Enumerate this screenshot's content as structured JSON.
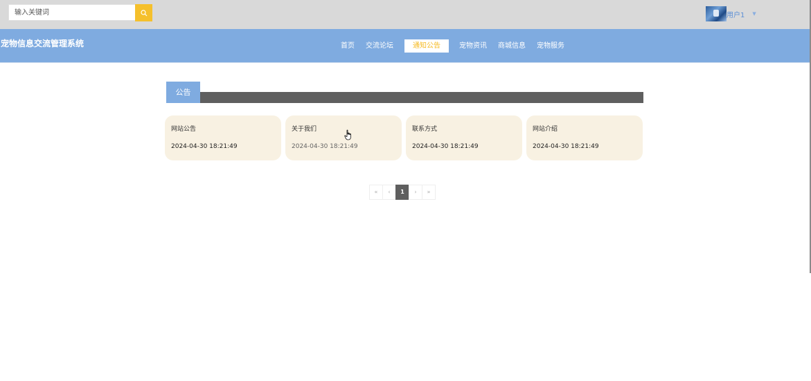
{
  "search": {
    "placeholder": "输入关键词",
    "button_icon": "search-icon"
  },
  "user": {
    "name": "用户1",
    "avatar_icon": "avatar-image",
    "caret_icon": "chevron-down-icon"
  },
  "header": {
    "site_title": "宠物信息交流管理系统"
  },
  "nav": {
    "items": [
      {
        "label": "首页"
      },
      {
        "label": "交流论坛"
      },
      {
        "label": "通知公告",
        "active": true
      },
      {
        "label": "宠物资讯"
      },
      {
        "label": "商城信息"
      },
      {
        "label": "宠物服务"
      }
    ]
  },
  "section": {
    "title": "公告"
  },
  "cards": [
    {
      "title": "网站公告",
      "date": "2024-04-30 18:21:49"
    },
    {
      "title": "关于我们",
      "date": "2024-04-30 18:21:49"
    },
    {
      "title": "联系方式",
      "date": "2024-04-30 18:21:49"
    },
    {
      "title": "网站介绍",
      "date": "2024-04-30 18:21:49"
    }
  ],
  "pagination": {
    "first": "«",
    "prev": "‹",
    "current": "1",
    "next": "›",
    "last": "»"
  },
  "colors": {
    "topbar": "#d9d9d9",
    "header": "#7fabe0",
    "accent": "#f5c02c",
    "nav_active_text": "#f5b921",
    "section_bar": "#5f5f5f",
    "card_bg": "#f8f1e2"
  }
}
